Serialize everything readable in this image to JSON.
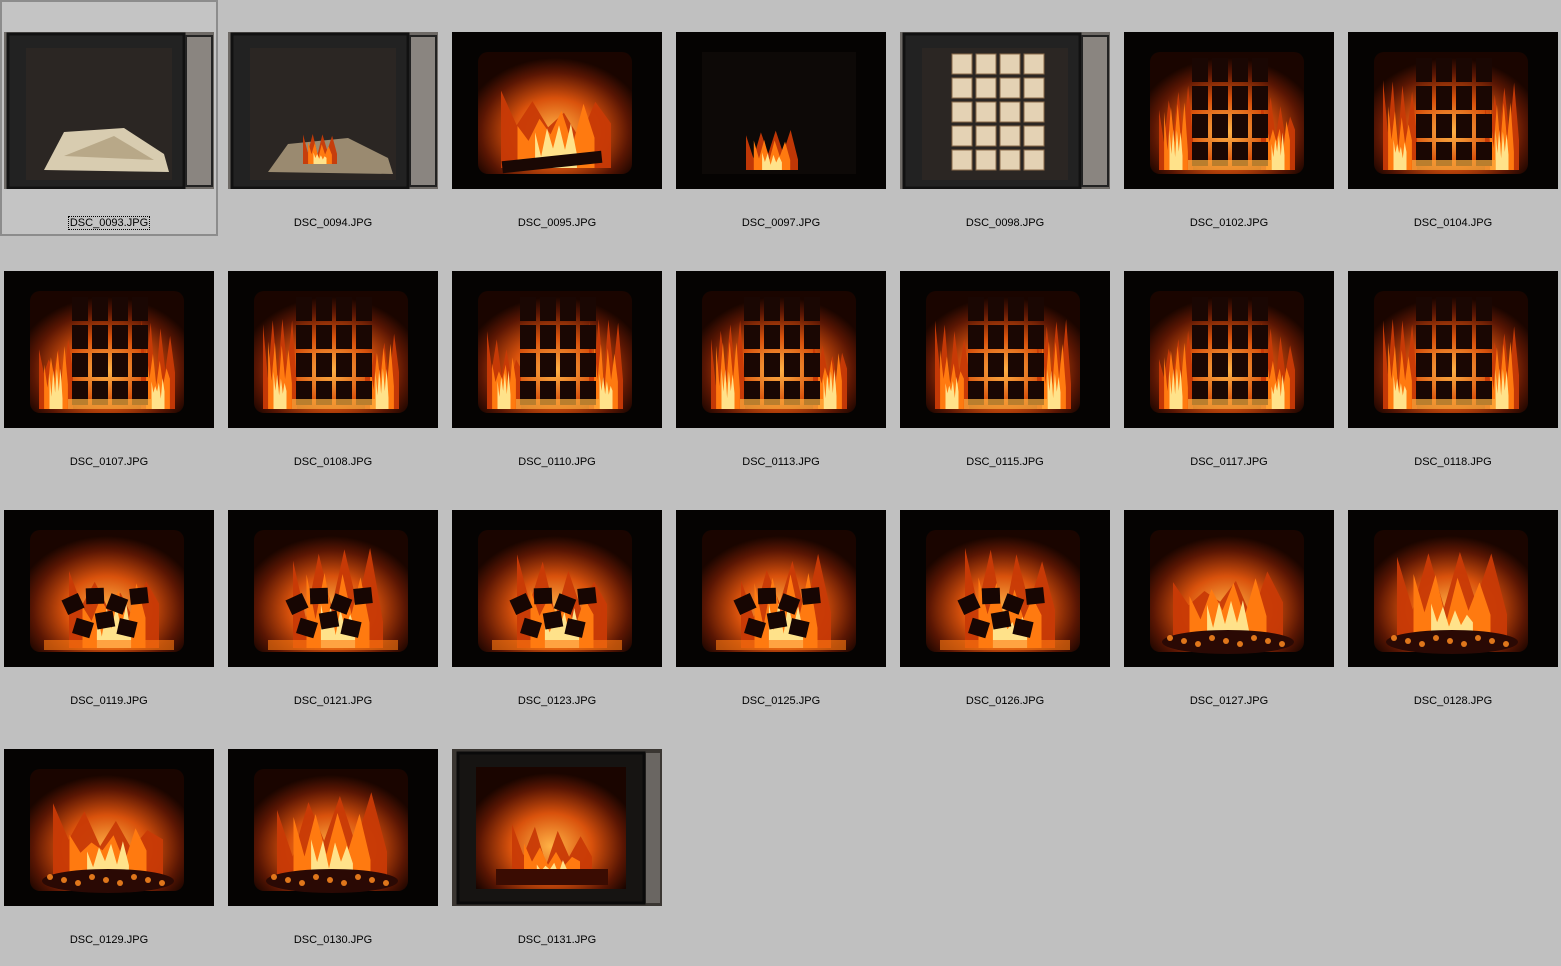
{
  "items": [
    {
      "name": "DSC_0093.JPG",
      "scene": "open-empty",
      "selected": true
    },
    {
      "name": "DSC_0094.JPG",
      "scene": "open-lit"
    },
    {
      "name": "DSC_0095.JPG",
      "scene": "big-flame"
    },
    {
      "name": "DSC_0097.JPG",
      "scene": "small-flame"
    },
    {
      "name": "DSC_0098.JPG",
      "scene": "open-stacked"
    },
    {
      "name": "DSC_0102.JPG",
      "scene": "stack-burn"
    },
    {
      "name": "DSC_0104.JPG",
      "scene": "stack-burn"
    },
    {
      "name": "DSC_0107.JPG",
      "scene": "stack-burn"
    },
    {
      "name": "DSC_0108.JPG",
      "scene": "stack-burn"
    },
    {
      "name": "DSC_0110.JPG",
      "scene": "stack-burn"
    },
    {
      "name": "DSC_0113.JPG",
      "scene": "stack-burn"
    },
    {
      "name": "DSC_0115.JPG",
      "scene": "stack-burn"
    },
    {
      "name": "DSC_0117.JPG",
      "scene": "stack-burn"
    },
    {
      "name": "DSC_0118.JPG",
      "scene": "stack-burn"
    },
    {
      "name": "DSC_0119.JPG",
      "scene": "logs-burn"
    },
    {
      "name": "DSC_0121.JPG",
      "scene": "logs-burn"
    },
    {
      "name": "DSC_0123.JPG",
      "scene": "logs-burn"
    },
    {
      "name": "DSC_0125.JPG",
      "scene": "logs-burn"
    },
    {
      "name": "DSC_0126.JPG",
      "scene": "logs-burn"
    },
    {
      "name": "DSC_0127.JPG",
      "scene": "embers-flame"
    },
    {
      "name": "DSC_0128.JPG",
      "scene": "embers-flame"
    },
    {
      "name": "DSC_0129.JPG",
      "scene": "embers-flame"
    },
    {
      "name": "DSC_0130.JPG",
      "scene": "embers-flame"
    },
    {
      "name": "DSC_0131.JPG",
      "scene": "framed-embers"
    }
  ],
  "colors": {
    "background": "#c0c0c0",
    "flame_outer": "#c83a06",
    "flame_mid": "#ff7a10",
    "flame_core": "#ffe28a"
  }
}
